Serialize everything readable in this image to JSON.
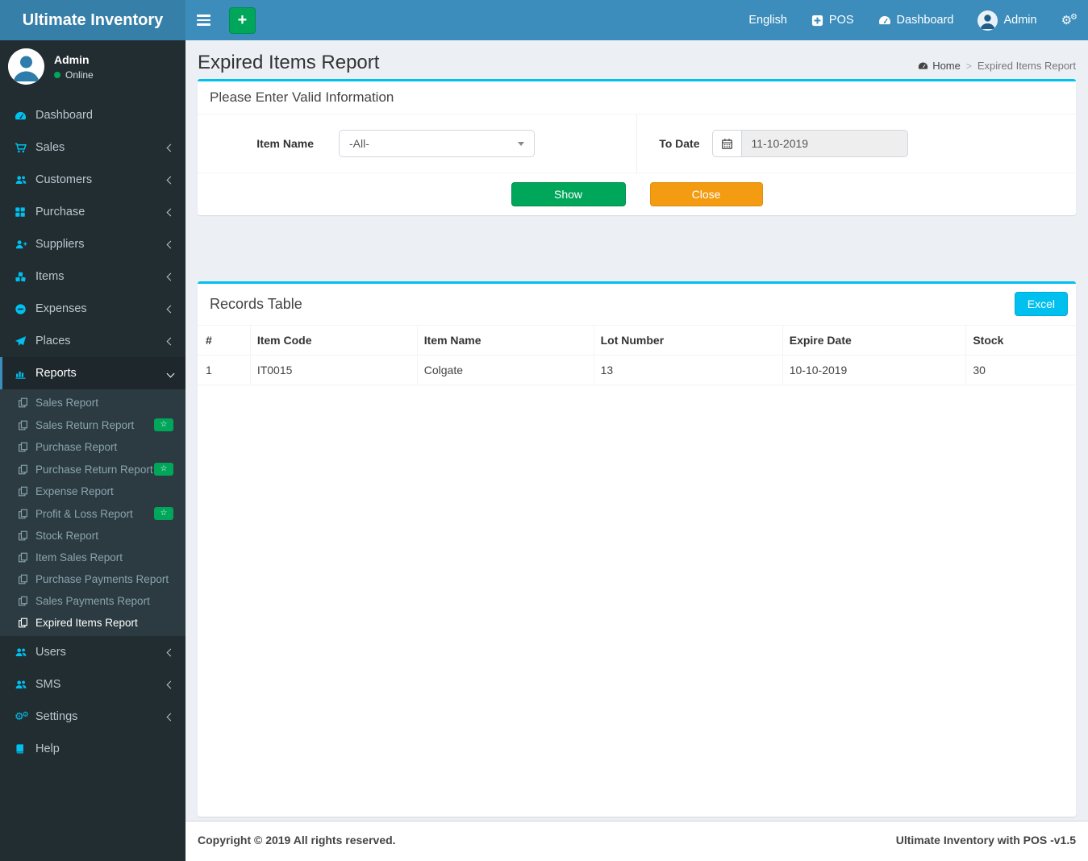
{
  "app": {
    "title": "Ultimate Inventory",
    "copyright": "Copyright © 2019 All rights reserved.",
    "version_label": "Ultimate Inventory with POS -v1.5"
  },
  "navbar": {
    "language": "English",
    "pos": "POS",
    "dashboard": "Dashboard",
    "user": "Admin"
  },
  "user_panel": {
    "name": "Admin",
    "status": "Online"
  },
  "sidebar": {
    "items": [
      {
        "label": "Dashboard",
        "icon": "tachometer-icon",
        "chevron": false
      },
      {
        "label": "Sales",
        "icon": "cart-icon",
        "chevron": true
      },
      {
        "label": "Customers",
        "icon": "users-icon",
        "chevron": true
      },
      {
        "label": "Purchase",
        "icon": "grid-icon",
        "chevron": true
      },
      {
        "label": "Suppliers",
        "icon": "user-plus-icon",
        "chevron": true
      },
      {
        "label": "Items",
        "icon": "cubes-icon",
        "chevron": true
      },
      {
        "label": "Expenses",
        "icon": "minus-circle-icon",
        "chevron": true
      },
      {
        "label": "Places",
        "icon": "paper-plane-icon",
        "chevron": true
      },
      {
        "label": "Reports",
        "icon": "bar-chart-icon",
        "chevron": "down",
        "active": true
      },
      {
        "label": "Users",
        "icon": "users-icon",
        "chevron": true
      },
      {
        "label": "SMS",
        "icon": "users-icon",
        "chevron": true
      },
      {
        "label": "Settings",
        "icon": "gears-icon",
        "chevron": true
      },
      {
        "label": "Help",
        "icon": "book-icon",
        "chevron": false
      }
    ],
    "reports_submenu": [
      {
        "label": "Sales Report",
        "badge": false
      },
      {
        "label": "Sales Return Report",
        "badge": true
      },
      {
        "label": "Purchase Report",
        "badge": false
      },
      {
        "label": "Purchase Return Report",
        "badge": true
      },
      {
        "label": "Expense Report",
        "badge": false
      },
      {
        "label": "Profit & Loss Report",
        "badge": true
      },
      {
        "label": "Stock Report",
        "badge": false
      },
      {
        "label": "Item Sales Report",
        "badge": false
      },
      {
        "label": "Purchase Payments Report",
        "badge": false
      },
      {
        "label": "Sales Payments Report",
        "badge": false
      },
      {
        "label": "Expired Items Report",
        "badge": false,
        "active": true
      }
    ]
  },
  "page": {
    "title": "Expired Items Report",
    "breadcrumb": {
      "home": "Home",
      "current": "Expired Items Report"
    }
  },
  "filter_panel": {
    "title": "Please Enter Valid Information",
    "item_name_label": "Item Name",
    "item_name_value": "-All-",
    "to_date_label": "To Date",
    "to_date_value": "11-10-2019",
    "show_button": "Show",
    "close_button": "Close"
  },
  "records": {
    "title": "Records Table",
    "excel_button": "Excel",
    "columns": [
      "#",
      "Item Code",
      "Item Name",
      "Lot Number",
      "Expire Date",
      "Stock"
    ],
    "rows": [
      [
        "1",
        "IT0015",
        "Colgate",
        "13",
        "10-10-2019",
        "30"
      ]
    ]
  },
  "icons": {
    "star_badge": "☆",
    "gear": "⚙"
  },
  "colors": {
    "navbar": "#3c8dbc",
    "logo_bg": "#367fa9",
    "sidebar_bg": "#222d32",
    "submenu_bg": "#2c3b41",
    "accent": "#00c0ef",
    "success": "#00a65a",
    "warning": "#f39c12",
    "sidebar_icon": "#00c0ef"
  }
}
